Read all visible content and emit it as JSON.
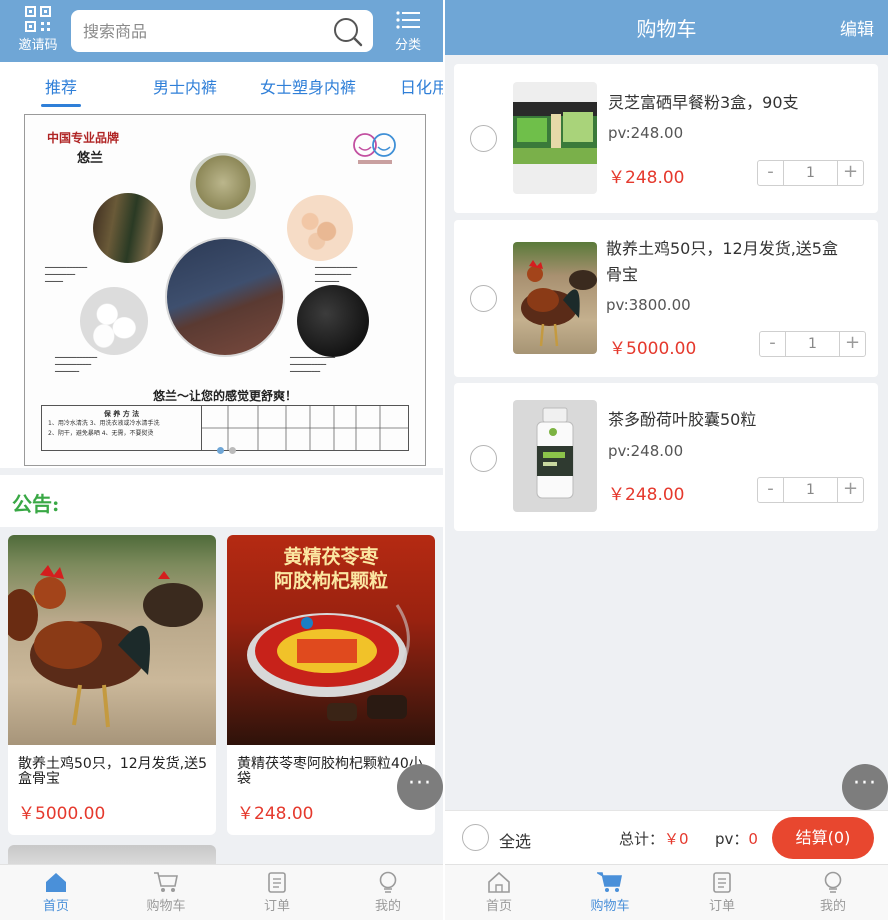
{
  "left": {
    "header": {
      "invite_label": "邀请码",
      "search_placeholder": "搜索商品",
      "category_label": "分类"
    },
    "tabs": [
      {
        "label": "推荐",
        "active": true
      },
      {
        "label": "男士内裤",
        "active": false
      },
      {
        "label": "女士塑身内裤",
        "active": false
      },
      {
        "label": "日化用",
        "active": false
      }
    ],
    "banner": {
      "brand": "中国专业品牌",
      "name": "悠兰",
      "slogan": "悠兰～让您的感觉更舒爽！",
      "care_title": "保 养 方 法",
      "care_lines": [
        "1、用冷水清洗    3、用洗衣液或冷水清手洗",
        "2、阴干，避免暴晒    4、无需，不要熨烫"
      ]
    },
    "notice_label": "公告:",
    "products": [
      {
        "name": "散养土鸡50只，12月发货,送5盒骨宝",
        "price": "￥5000.00"
      },
      {
        "name": "黄精茯苓枣阿胶枸杞颗粒40小袋",
        "price": "￥248.00"
      }
    ],
    "product2_banner": {
      "line1": "黄精茯苓枣",
      "line2": "阿胶枸杞颗粒"
    },
    "more_label": "···"
  },
  "right": {
    "header": {
      "title": "购物车",
      "edit_label": "编辑"
    },
    "items": [
      {
        "title": "灵芝富硒早餐粉3盒，90支",
        "pv": "pv:248.00",
        "price": "￥248.00",
        "qty": "1"
      },
      {
        "title_line1": "散养土鸡50只，12月发货,送5盒",
        "title_line2": "骨宝",
        "pv": "pv:3800.00",
        "price": "￥5000.00",
        "qty": "1"
      },
      {
        "title": "茶多酚荷叶胶囊50粒",
        "pv": "pv:248.00",
        "price": "￥248.00",
        "qty": "1"
      }
    ],
    "checkout_bar": {
      "select_all": "全选",
      "total_label": "总计：",
      "total_value": "￥0",
      "pv_label": "pv：",
      "pv_value": "0",
      "checkout_label": "结算(0)"
    },
    "more_label": "···"
  },
  "nav": {
    "items": [
      {
        "label": "首页"
      },
      {
        "label": "购物车"
      },
      {
        "label": "订单"
      },
      {
        "label": "我的"
      }
    ]
  },
  "colors": {
    "header_bg": "#6fa6d6",
    "accent_blue": "#2f7fd8",
    "price_red": "#e5392d",
    "checkout_red": "#e8472f",
    "notice_green": "#39a845"
  }
}
